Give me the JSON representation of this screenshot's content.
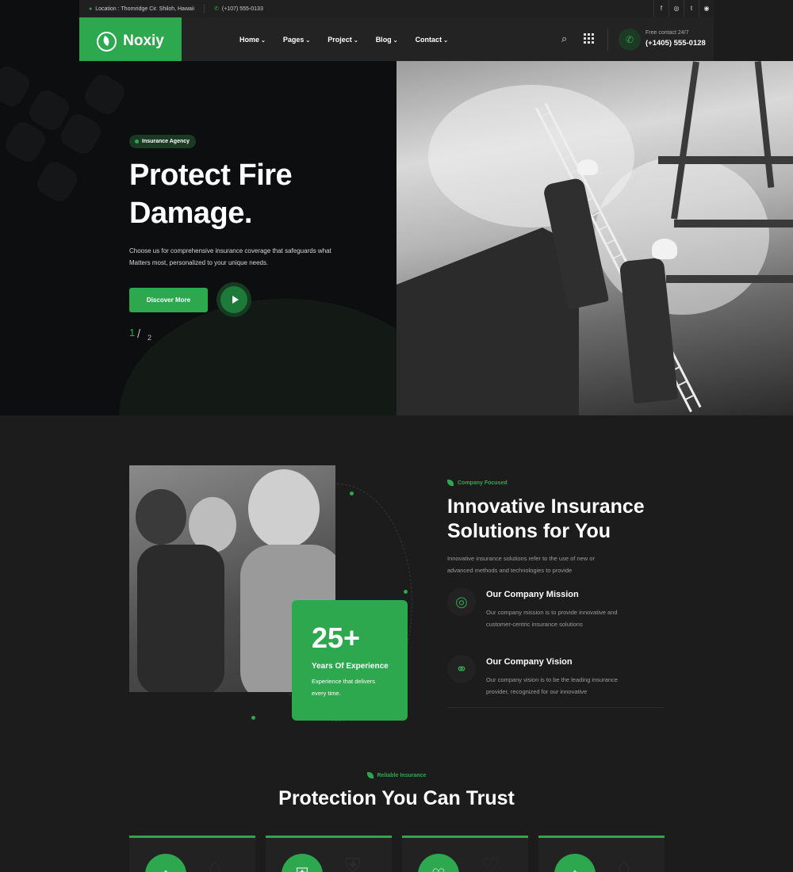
{
  "topbar": {
    "location": "Location : Thornridge Cir. Shiloh, Hawaii",
    "phone": "(+107) 555-0133",
    "socials": [
      "f",
      "◎",
      "t",
      "◉"
    ]
  },
  "header": {
    "logo_text": "Noxiy",
    "nav": [
      {
        "label": "Home"
      },
      {
        "label": "Pages"
      },
      {
        "label": "Project"
      },
      {
        "label": "Blog"
      },
      {
        "label": "Contact"
      }
    ],
    "contact_label": "Free contact 24/7",
    "contact_phone": "(+1405) 555-0128"
  },
  "hero": {
    "badge": "Insurance Agency",
    "title_line1": "Protect Fire",
    "title_line2": "Damage.",
    "description_line1": "Choose us for comprehensive insurance coverage that safeguards what",
    "description_line2": "Matters most, personalized to your unique needs.",
    "button": "Discover More",
    "slide_current": "1",
    "slide_sep": "/",
    "slide_total": "2"
  },
  "about": {
    "experience_number": "25+",
    "experience_label": "Years Of Experience",
    "experience_desc": "Experience that delivers every time.",
    "tag": "Company Focused",
    "title_line1": "Innovative Insurance",
    "title_line2": "Solutions for You",
    "desc_line1": "Innovative insurance solutions refer to the use of new or",
    "desc_line2": "advanced methods and technologies to provide",
    "features": [
      {
        "title": "Our Company Mission",
        "desc_line1": "Our company mission is to provide innovative and",
        "desc_line2": "customer-centric insurance solutions",
        "icon": "target-icon"
      },
      {
        "title": "Our Company Vision",
        "desc_line1": "Our company vision is to be the leading insurance",
        "desc_line2": "provider, recognized for our innovative",
        "icon": "binoculars-icon"
      }
    ]
  },
  "protection": {
    "tag": "Reliable Insurance",
    "title": "Protection You Can Trust",
    "cards": [
      {
        "icon": "house-shield-icon"
      },
      {
        "icon": "hand-shield-icon"
      },
      {
        "icon": "handshake-icon"
      },
      {
        "icon": "home-icon"
      }
    ]
  },
  "colors": {
    "accent": "#2ea84f",
    "background": "#1c1c1c",
    "hero_background": "#0d0e0f"
  }
}
